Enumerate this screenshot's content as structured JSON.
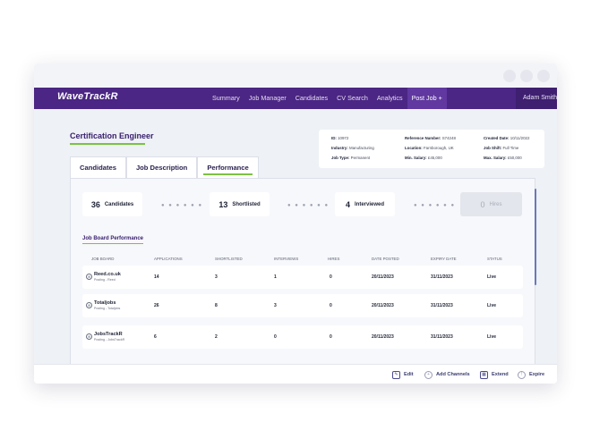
{
  "nav": {
    "logo": "WaveTrackR",
    "items": [
      "Summary",
      "Job Manager",
      "Candidates",
      "CV Search",
      "Analytics",
      "Post Job +"
    ],
    "active_item": "Post Job +",
    "user": "Adam Smith"
  },
  "job": {
    "title": "Certification Engineer",
    "info": {
      "id_label": "ID:",
      "id_value": "10972",
      "ref_label": "Reference Number:",
      "ref_value": "S74248",
      "created_label": "Created Date:",
      "created_value": "10/11/2022",
      "industry_label": "Industry:",
      "industry_value": "Manufacturing",
      "location_label": "Location:",
      "location_value": "Farnborough, UK",
      "shift_label": "Job Shift:",
      "shift_value": "Full Time",
      "type_label": "Job Type:",
      "type_value": "Permanent",
      "min_label": "Min. Salary:",
      "min_value": "£45,000",
      "max_label": "Max. Salary:",
      "max_value": "£50,000"
    }
  },
  "tabs": [
    "Candidates",
    "Job Description",
    "Performance"
  ],
  "active_tab": "Performance",
  "stats": [
    {
      "num": "36",
      "label": "Candidates"
    },
    {
      "num": "13",
      "label": "Shortlisted"
    },
    {
      "num": "4",
      "label": "Interviewed"
    },
    {
      "num": "0",
      "label": "Hires"
    }
  ],
  "dots": "● ● ● ● ● ●",
  "performance": {
    "section_title": "Job Board Performance",
    "headers": [
      "Job Board",
      "Applications",
      "Shortlisted",
      "Interviews",
      "Hires",
      "Date Posted",
      "Expiry Date",
      "Status"
    ],
    "rows": [
      {
        "name": "Reed.co.uk",
        "sub": "Posting - Reed",
        "applications": "14",
        "shortlisted": "3",
        "interviews": "1",
        "hires": "0",
        "date_posted": "20/11/2023",
        "expiry_date": "31/11/2023",
        "status": "Live"
      },
      {
        "name": "Totaljobs",
        "sub": "Posting - Totaljobs",
        "applications": "26",
        "shortlisted": "8",
        "interviews": "3",
        "hires": "0",
        "date_posted": "20/11/2023",
        "expiry_date": "31/11/2023",
        "status": "Live"
      },
      {
        "name": "JobsTrackR",
        "sub": "Posting - JobsTrackR",
        "applications": "6",
        "shortlisted": "2",
        "interviews": "0",
        "hires": "0",
        "date_posted": "20/11/2023",
        "expiry_date": "31/11/2023",
        "status": "Live"
      }
    ]
  },
  "footer": {
    "buttons": [
      {
        "label": "Edit",
        "icon": "edit-icon"
      },
      {
        "label": "Add Channels",
        "icon": "add-icon"
      },
      {
        "label": "Extend",
        "icon": "calendar-icon"
      },
      {
        "label": "Expire",
        "icon": "warning-icon"
      }
    ]
  },
  "colors": {
    "nav_bg": "#4b2684",
    "accent_green": "#7cc242",
    "title_purple": "#3a2070"
  }
}
